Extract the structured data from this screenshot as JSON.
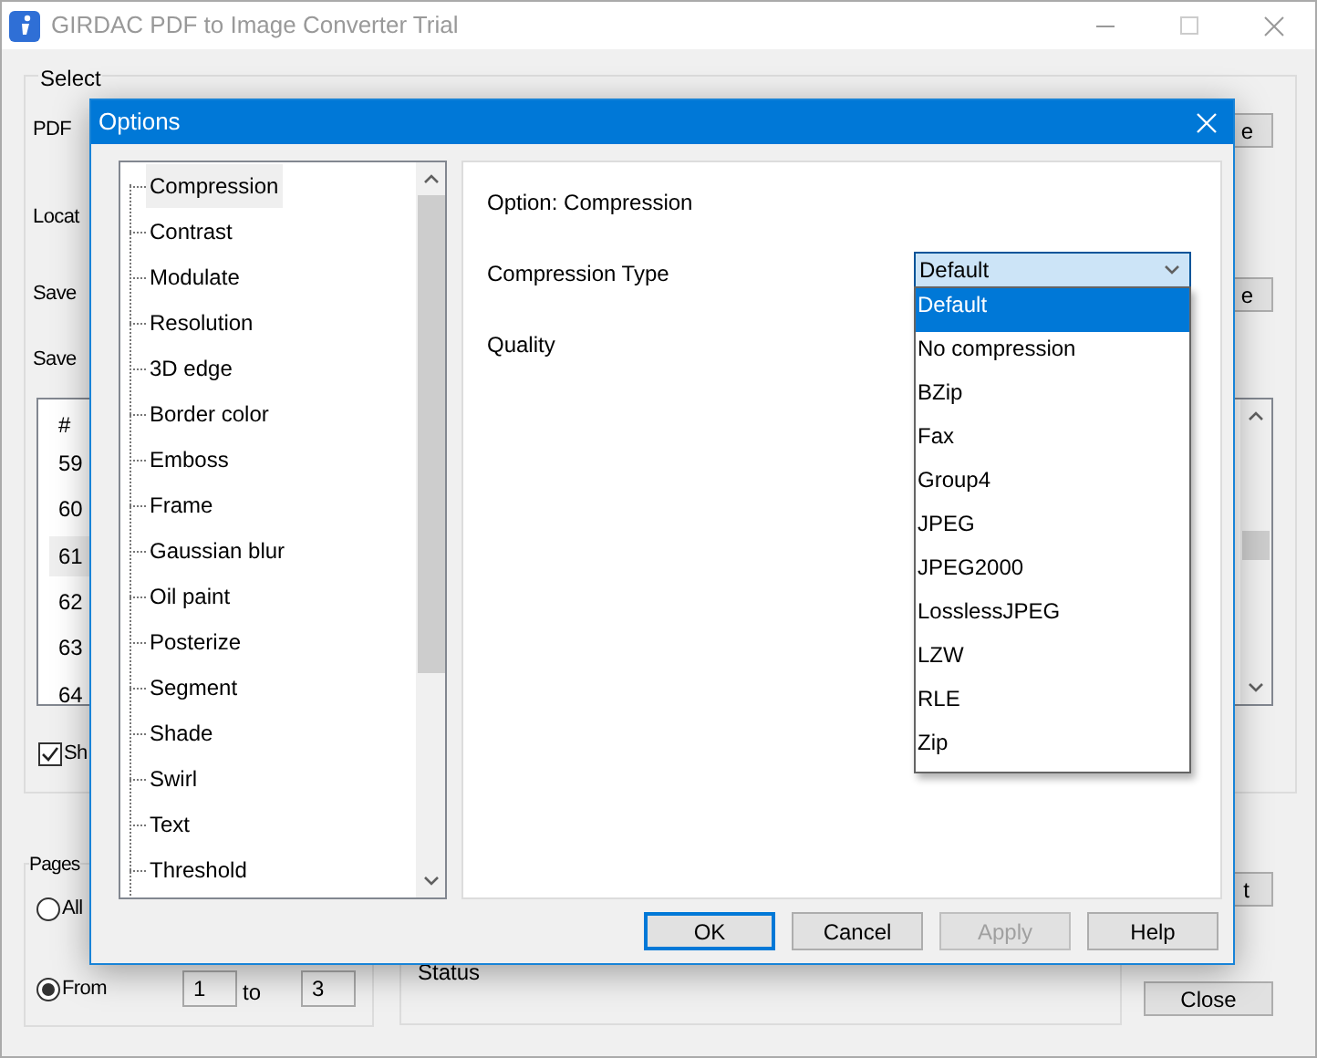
{
  "window": {
    "title": "GIRDAC PDF to Image Converter Trial"
  },
  "main": {
    "group_title": "Select",
    "labels": [
      "PDF",
      "Locat",
      "Save",
      "Save"
    ],
    "side_buttons": [
      "e",
      "e"
    ],
    "list": {
      "header": "#",
      "rows": [
        {
          "text": "59",
          "selected": false
        },
        {
          "text": "60",
          "selected": false
        },
        {
          "text": "61",
          "selected": true
        },
        {
          "text": "62",
          "selected": false
        },
        {
          "text": "63",
          "selected": false
        },
        {
          "text": "64",
          "selected": false
        }
      ]
    },
    "checkbox": {
      "label": "Sh",
      "checked": true
    },
    "pages": {
      "title": "Pages",
      "radios": [
        {
          "label": "All",
          "selected": false
        },
        {
          "label": "From",
          "selected": true
        }
      ],
      "from": "1",
      "to_label": "to",
      "to": "3"
    },
    "status": "Status",
    "lower_button": "t",
    "close_button": "Close"
  },
  "dialog": {
    "title": "Options",
    "tree": [
      {
        "label": "Compression",
        "selected": true
      },
      {
        "label": "Contrast",
        "selected": false
      },
      {
        "label": "Modulate",
        "selected": false
      },
      {
        "label": "Resolution",
        "selected": false
      },
      {
        "label": "3D edge",
        "selected": false
      },
      {
        "label": "Border color",
        "selected": false
      },
      {
        "label": "Emboss",
        "selected": false
      },
      {
        "label": "Frame",
        "selected": false
      },
      {
        "label": "Gaussian blur",
        "selected": false
      },
      {
        "label": "Oil paint",
        "selected": false
      },
      {
        "label": "Posterize",
        "selected": false
      },
      {
        "label": "Segment",
        "selected": false
      },
      {
        "label": "Shade",
        "selected": false
      },
      {
        "label": "Swirl",
        "selected": false
      },
      {
        "label": "Text",
        "selected": false
      },
      {
        "label": "Threshold",
        "selected": false
      }
    ],
    "option_title": "Option: Compression",
    "field_labels": [
      "Compression Type",
      "Quality"
    ],
    "combo": {
      "value": "Default",
      "expanded": true,
      "options": [
        {
          "label": "Default",
          "selected": true
        },
        {
          "label": "No compression",
          "selected": false
        },
        {
          "label": "BZip",
          "selected": false
        },
        {
          "label": "Fax",
          "selected": false
        },
        {
          "label": "Group4",
          "selected": false
        },
        {
          "label": "JPEG",
          "selected": false
        },
        {
          "label": "JPEG2000",
          "selected": false
        },
        {
          "label": "LosslessJPEG",
          "selected": false
        },
        {
          "label": "LZW",
          "selected": false
        },
        {
          "label": "RLE",
          "selected": false
        },
        {
          "label": "Zip",
          "selected": false
        }
      ]
    },
    "buttons": [
      {
        "label": "OK",
        "focused": true,
        "disabled": false
      },
      {
        "label": "Cancel",
        "focused": false,
        "disabled": false
      },
      {
        "label": "Apply",
        "focused": false,
        "disabled": true
      },
      {
        "label": "Help",
        "focused": false,
        "disabled": false
      }
    ]
  }
}
